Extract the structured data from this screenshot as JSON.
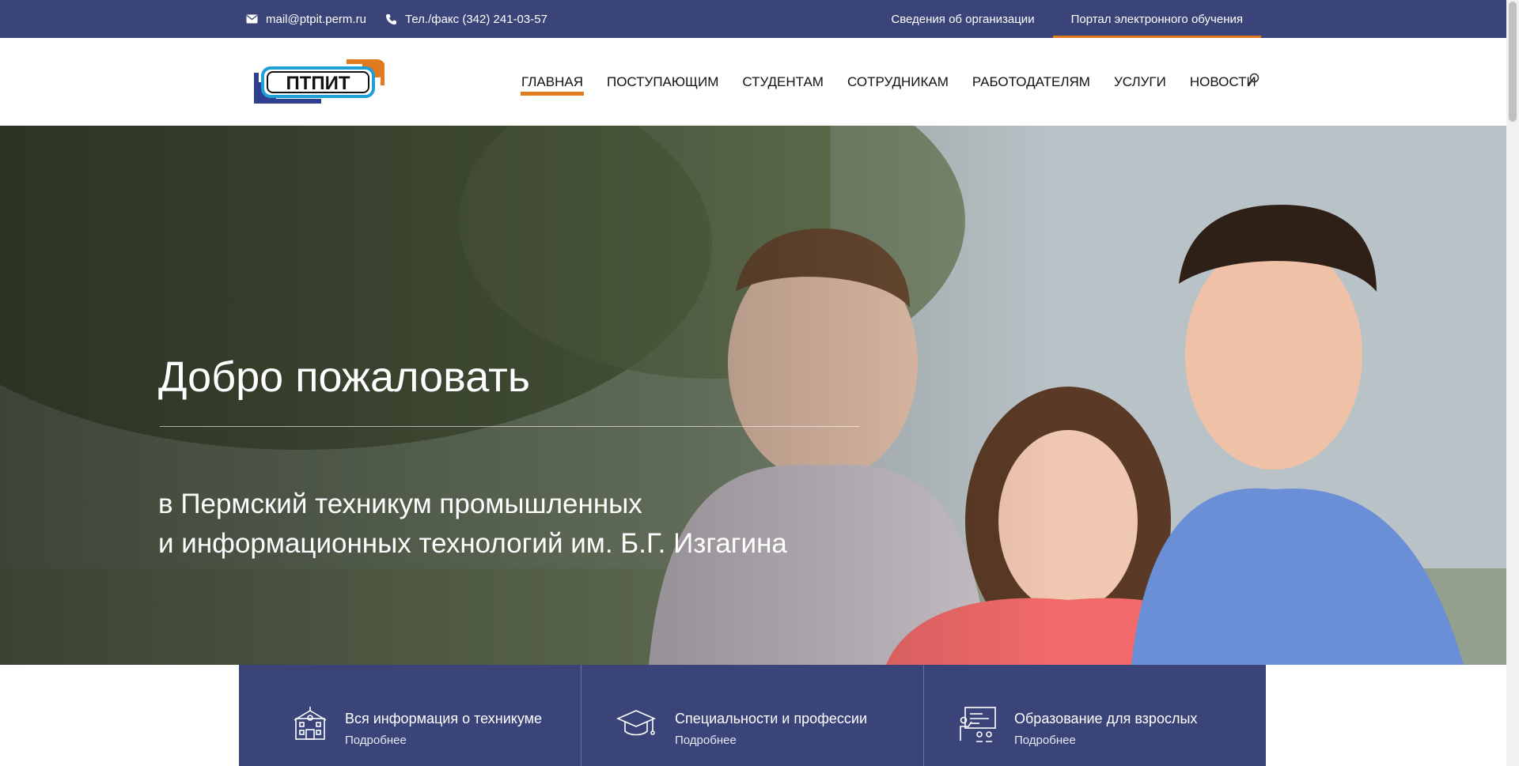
{
  "topbar": {
    "email": "mail@ptpit.perm.ru",
    "phone": "Тел./факс (342) 241-03-57",
    "links": [
      {
        "label": "Сведения об организации"
      },
      {
        "label": "Портал электронного обучения"
      }
    ]
  },
  "header": {
    "logo_text": "ПТПИТ",
    "nav": [
      {
        "label": "ГЛАВНАЯ"
      },
      {
        "label": "ПОСТУПАЮЩИМ"
      },
      {
        "label": "СТУДЕНТАМ"
      },
      {
        "label": "СОТРУДНИКАМ"
      },
      {
        "label": "РАБОТОДАТЕЛЯМ"
      },
      {
        "label": "УСЛУГИ"
      },
      {
        "label": "НОВОСТИ"
      }
    ]
  },
  "hero": {
    "title": "Добро пожаловать",
    "subtitle_line1": "в Пермский техникум промышленных",
    "subtitle_line2": "и информационных технологий им. Б.Г. Изгагина"
  },
  "cards": [
    {
      "title": "Вся информация о техникуме",
      "more": "Подробнее",
      "icon": "school-building-icon"
    },
    {
      "title": "Специальности и профессии",
      "more": "Подробнее",
      "icon": "graduation-cap-icon"
    },
    {
      "title": "Образование для взрослых",
      "more": "Подробнее",
      "icon": "teacher-board-icon"
    }
  ],
  "colors": {
    "brand_blue": "#3a4478",
    "accent_orange": "#e07a1f"
  }
}
